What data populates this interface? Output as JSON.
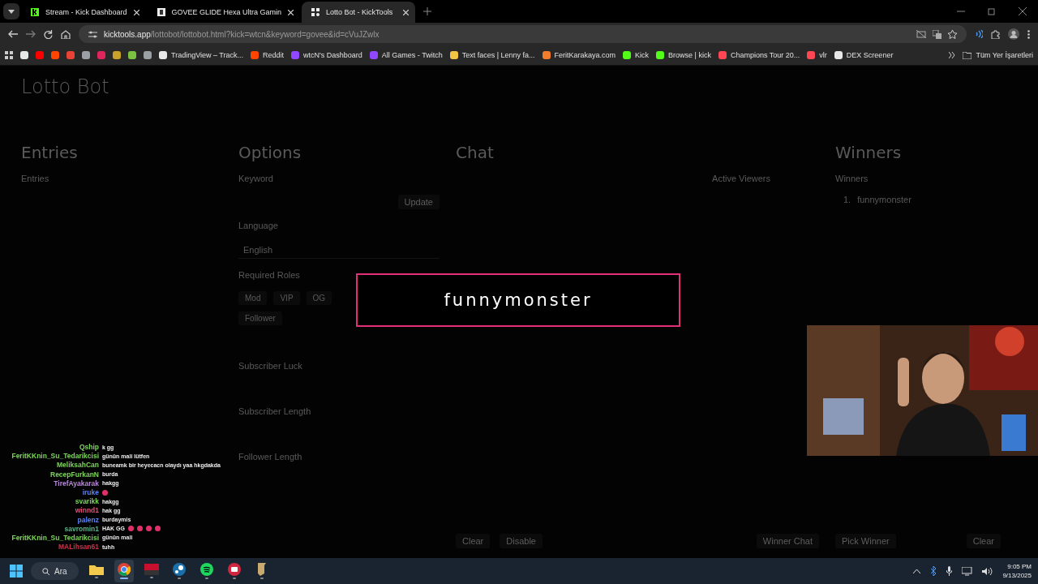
{
  "browser": {
    "tabs": [
      {
        "title": "Stream - Kick Dashboard",
        "kind": "kick",
        "selected": false
      },
      {
        "title": "GOVEE GLIDE Hexa Ultra Gamin",
        "kind": "govee",
        "selected": false
      },
      {
        "title": "Lotto Bot - KickTools",
        "kind": "grid",
        "selected": true
      }
    ],
    "address": {
      "domain": "kicktools.app",
      "path": "/lottobot/lottobot.html?kick=wtcn&keyword=govee&id=cVuJZwlx"
    },
    "bookmarks": [
      {
        "kind": "icon",
        "color": "#e8e8e8"
      },
      {
        "kind": "icon",
        "color": "#ff0000"
      },
      {
        "kind": "icon",
        "color": "#ff4500"
      },
      {
        "kind": "icon",
        "color": "#ea4335"
      },
      {
        "kind": "icon",
        "color": "#9aa0a6"
      },
      {
        "kind": "icon",
        "color": "#e0245e"
      },
      {
        "kind": "icon",
        "color": "#c9a227"
      },
      {
        "kind": "icon",
        "color": "#7cc242"
      },
      {
        "kind": "icon",
        "color": "#9aa0a6"
      },
      {
        "kind": "label",
        "label": "TradingView – Track...",
        "color": "#e8e8e8"
      },
      {
        "kind": "label",
        "label": "Reddit",
        "color": "#ff4500"
      },
      {
        "kind": "label",
        "label": "wtcN's Dashboard",
        "color": "#9146ff"
      },
      {
        "kind": "label",
        "label": "All Games - Twitch",
        "color": "#9146ff"
      },
      {
        "kind": "label",
        "label": "Text faces | Lenny fa...",
        "color": "#f4c542"
      },
      {
        "kind": "label",
        "label": "FeritKarakaya.com",
        "color": "#f07c2c"
      },
      {
        "kind": "label",
        "label": "Kick",
        "color": "#53fc18"
      },
      {
        "kind": "label",
        "label": "Browse | kick",
        "color": "#53fc18"
      },
      {
        "kind": "label",
        "label": "Champions Tour 20...",
        "color": "#ff4655"
      },
      {
        "kind": "label",
        "label": "vlr",
        "color": "#ff4655"
      },
      {
        "kind": "label",
        "label": "DEX Screener",
        "color": "#e8e8e8"
      }
    ],
    "all_bookmarks": "Tüm Yer İşaretleri"
  },
  "lotto_page": {
    "title": "Lotto Bot",
    "entries": {
      "heading": "Entries",
      "label": "Entries"
    },
    "options": {
      "heading": "Options",
      "keyword_label": "Keyword",
      "update_button": "Update",
      "language_label": "Language",
      "language": "English",
      "roles_label": "Required Roles",
      "roles": [
        {
          "label": "Mod"
        },
        {
          "label": "VIP"
        },
        {
          "label": "OG"
        },
        {
          "label": "Follower"
        }
      ],
      "fields": [
        "Subscriber Luck",
        "Subscriber Length",
        "Follower Length"
      ]
    },
    "chat": {
      "heading": "Chat",
      "active_viewers": "Active Viewers",
      "buttons": [
        "Clear",
        "Disable"
      ],
      "winner_chat": "Winner Chat"
    },
    "winners": {
      "heading": "Winners",
      "label": "Winners",
      "list": [
        {
          "rank": "1.",
          "name": "funnymonster"
        }
      ],
      "buttons": [
        "Pick Winner",
        "Clear"
      ]
    }
  },
  "winner_popup": {
    "name": "funnymonster"
  },
  "stream_chat": [
    {
      "name": "Qship",
      "color": "#7cd65a",
      "parts": [
        {
          "kind": "text",
          "text": "k gg"
        }
      ]
    },
    {
      "name": "FeritKKnin_Su_Tedarikcisi",
      "color": "#7cd65a",
      "parts": [
        {
          "kind": "text",
          "text": "günün mali lütfen"
        }
      ]
    },
    {
      "name": "MeliksahCan",
      "color": "#7cd65a",
      "parts": [
        {
          "kind": "text",
          "text": "buneamk bir heyecacn olaydı yaa hkgdakda"
        }
      ]
    },
    {
      "name": "RecepFurkanN",
      "color": "#7cd65a",
      "parts": [
        {
          "kind": "text",
          "text": "burda"
        }
      ]
    },
    {
      "name": "TirefAyakarak",
      "color": "#b88ad8",
      "parts": [
        {
          "kind": "text",
          "text": "hakgg"
        }
      ]
    },
    {
      "name": "iruke",
      "color": "#5b82f0",
      "parts": [
        {
          "kind": "emote"
        }
      ]
    },
    {
      "name": "svarikk",
      "color": "#7cd65a",
      "parts": [
        {
          "kind": "text",
          "text": "hakgg"
        }
      ]
    },
    {
      "name": "winnd1",
      "color": "#e0507a",
      "parts": [
        {
          "kind": "text",
          "text": "hak gg"
        }
      ]
    },
    {
      "name": "palenz",
      "color": "#5b82f0",
      "parts": [
        {
          "kind": "text",
          "text": "burdaymis"
        }
      ]
    },
    {
      "name": "savromin1",
      "color": "#5ab48a",
      "parts": [
        {
          "kind": "text",
          "text": "HAK GG"
        },
        {
          "kind": "emote"
        },
        {
          "kind": "emote"
        },
        {
          "kind": "emote"
        },
        {
          "kind": "emote"
        }
      ]
    },
    {
      "name": "FeritKKnin_Su_Tedarikcisi",
      "color": "#7cd65a",
      "parts": [
        {
          "kind": "text",
          "text": "günün mali"
        }
      ]
    },
    {
      "name": "MALihsan61",
      "color": "#d0304a",
      "parts": [
        {
          "kind": "text",
          "text": "tuhh"
        }
      ]
    }
  ],
  "taskbar": {
    "search": "Ara",
    "apps": [
      {
        "kind": "files",
        "selected": false
      },
      {
        "kind": "chrome",
        "selected": true
      },
      {
        "kind": "voicemod",
        "selected": false
      },
      {
        "kind": "steam",
        "selected": false
      },
      {
        "kind": "spotify",
        "selected": false
      },
      {
        "kind": "red",
        "selected": false
      },
      {
        "kind": "league",
        "selected": false
      }
    ],
    "time": "9:05 PM",
    "date": "9/13/2025"
  }
}
